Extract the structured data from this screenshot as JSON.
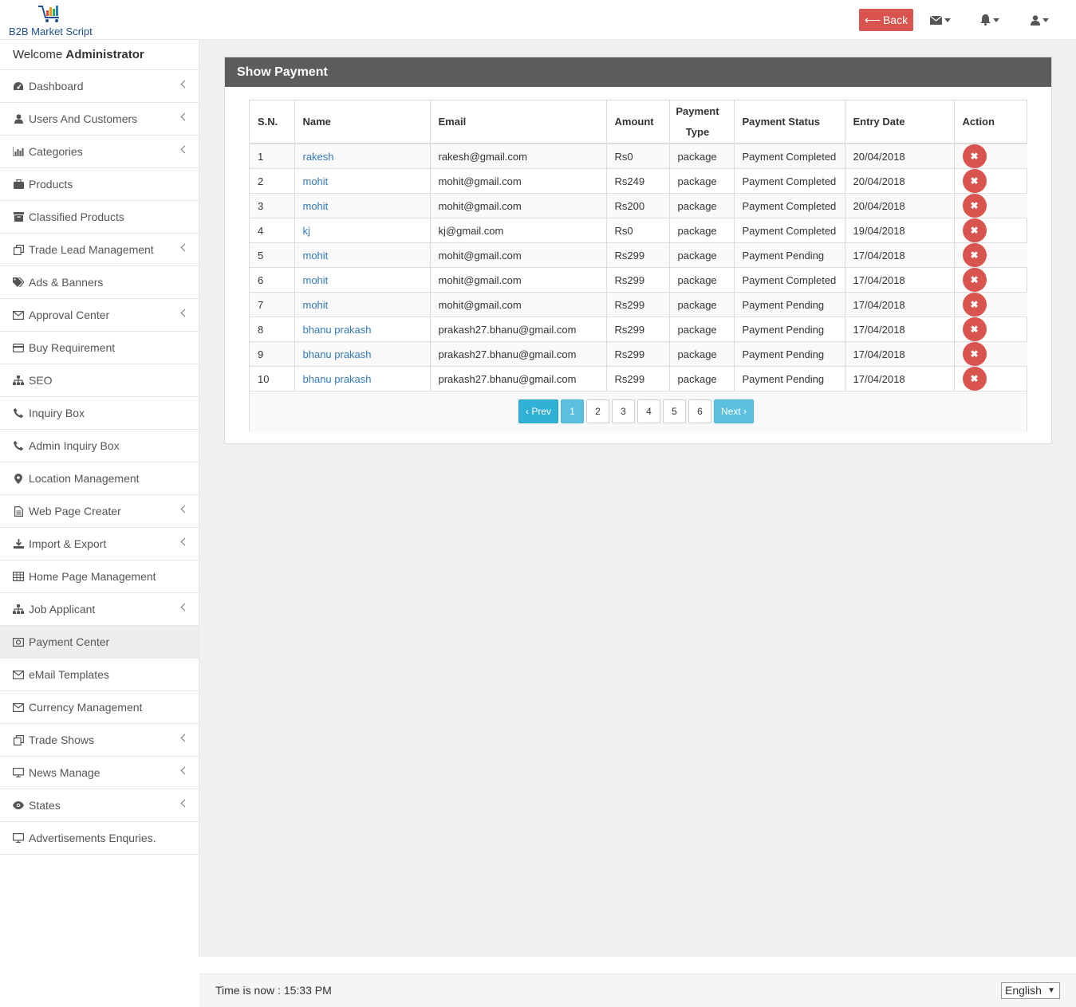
{
  "brand": {
    "name": "B2B Market Script"
  },
  "header": {
    "back_label": "Back"
  },
  "sidebar": {
    "welcome_prefix": "Welcome ",
    "welcome_user": "Administrator",
    "items": [
      {
        "label": "Dashboard",
        "icon": "dashboard-icon",
        "chevron": true
      },
      {
        "label": "Users And Customers",
        "icon": "user-icon",
        "chevron": true
      },
      {
        "label": "Categories",
        "icon": "bar-chart-icon",
        "chevron": true
      },
      {
        "label": "Products",
        "icon": "briefcase-icon",
        "chevron": false
      },
      {
        "label": "Classified Products",
        "icon": "archive-icon",
        "chevron": false
      },
      {
        "label": "Trade Lead Management",
        "icon": "clone-icon",
        "chevron": true
      },
      {
        "label": "Ads & Banners",
        "icon": "tags-icon",
        "chevron": false
      },
      {
        "label": "Approval Center",
        "icon": "envelope-icon",
        "chevron": true
      },
      {
        "label": "Buy Requirement",
        "icon": "credit-card-icon",
        "chevron": false
      },
      {
        "label": "SEO",
        "icon": "sitemap-icon",
        "chevron": false
      },
      {
        "label": "Inquiry Box",
        "icon": "phone-icon",
        "chevron": false
      },
      {
        "label": "Admin Inquiry Box",
        "icon": "phone-icon",
        "chevron": false
      },
      {
        "label": "Location Management",
        "icon": "map-marker-icon",
        "chevron": false
      },
      {
        "label": "Web Page Creater",
        "icon": "file-icon",
        "chevron": true
      },
      {
        "label": "Import & Export",
        "icon": "download-icon",
        "chevron": true
      },
      {
        "label": "Home Page Management",
        "icon": "table-icon",
        "chevron": false
      },
      {
        "label": "Job Applicant",
        "icon": "sitemap-icon",
        "chevron": true
      },
      {
        "label": "Payment Center",
        "icon": "money-icon",
        "chevron": false,
        "active": true
      },
      {
        "label": "eMail Templates",
        "icon": "envelope-icon",
        "chevron": false
      },
      {
        "label": "Currency Management",
        "icon": "envelope-icon",
        "chevron": false
      },
      {
        "label": "Trade Shows",
        "icon": "clone-icon",
        "chevron": true
      },
      {
        "label": "News Manage",
        "icon": "monitor-icon",
        "chevron": true
      },
      {
        "label": "States",
        "icon": "eye-icon",
        "chevron": true
      },
      {
        "label": "Advertisements Enquries.",
        "icon": "monitor-icon",
        "chevron": false
      }
    ]
  },
  "panel": {
    "title": "Show Payment"
  },
  "table": {
    "headers": [
      "S.N.",
      "Name",
      "Email",
      "Amount",
      "Payment Type",
      "Payment Status",
      "Entry Date",
      "Action"
    ],
    "rows": [
      {
        "sn": "1",
        "name": "rakesh",
        "email": "rakesh@gmail.com",
        "amount": "Rs0",
        "type": "package",
        "status": "Payment Completed",
        "date": "20/04/2018"
      },
      {
        "sn": "2",
        "name": "mohit",
        "email": "mohit@gmail.com",
        "amount": "Rs249",
        "type": "package",
        "status": "Payment Completed",
        "date": "20/04/2018"
      },
      {
        "sn": "3",
        "name": "mohit",
        "email": "mohit@gmail.com",
        "amount": "Rs200",
        "type": "package",
        "status": "Payment Completed",
        "date": "20/04/2018"
      },
      {
        "sn": "4",
        "name": "kj",
        "email": "kj@gmail.com",
        "amount": "Rs0",
        "type": "package",
        "status": "Payment Completed",
        "date": "19/04/2018"
      },
      {
        "sn": "5",
        "name": "mohit",
        "email": "mohit@gmail.com",
        "amount": "Rs299",
        "type": "package",
        "status": "Payment Pending",
        "date": "17/04/2018"
      },
      {
        "sn": "6",
        "name": "mohit",
        "email": "mohit@gmail.com",
        "amount": "Rs299",
        "type": "package",
        "status": "Payment Completed",
        "date": "17/04/2018"
      },
      {
        "sn": "7",
        "name": "mohit",
        "email": "mohit@gmail.com",
        "amount": "Rs299",
        "type": "package",
        "status": "Payment Pending",
        "date": "17/04/2018"
      },
      {
        "sn": "8",
        "name": "bhanu prakash",
        "email": "prakash27.bhanu@gmail.com",
        "amount": "Rs299",
        "type": "package",
        "status": "Payment Pending",
        "date": "17/04/2018"
      },
      {
        "sn": "9",
        "name": "bhanu prakash",
        "email": "prakash27.bhanu@gmail.com",
        "amount": "Rs299",
        "type": "package",
        "status": "Payment Pending",
        "date": "17/04/2018"
      },
      {
        "sn": "10",
        "name": "bhanu prakash",
        "email": "prakash27.bhanu@gmail.com",
        "amount": "Rs299",
        "type": "package",
        "status": "Payment Pending",
        "date": "17/04/2018"
      }
    ]
  },
  "pagination": {
    "prev_label": "‹ Prev",
    "next_label": "Next ›",
    "pages": [
      "1",
      "2",
      "3",
      "4",
      "5",
      "6"
    ],
    "current": "1"
  },
  "footer": {
    "time_text": "Time is now : 15:33 PM",
    "language": "English"
  },
  "colors": {
    "danger": "#d9534f",
    "info": "#5bc0de",
    "panel_header": "#5c5c5c",
    "link": "#337ab7"
  }
}
